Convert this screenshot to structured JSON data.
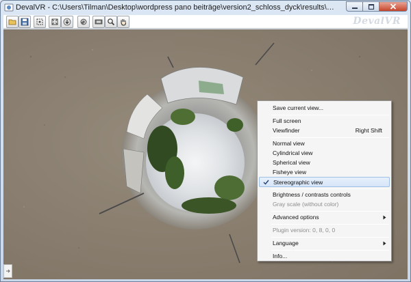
{
  "window": {
    "title": "DevalVR - C:\\Users\\Tilman\\Desktop\\wordpress pano beiträge\\version2_schloss_dyck\\results\\kasse_tag.tif"
  },
  "caption_buttons": [
    "minimize-icon",
    "maximize-icon",
    "close-icon"
  ],
  "toolbar": {
    "buttons": [
      "open-icon",
      "save-icon",
      "fit-icon",
      "zoom-fit-icon",
      "download-icon",
      "rotate-icon",
      "panorama-icon",
      "zoom-icon",
      "hand-icon"
    ],
    "brand": "DevalVR"
  },
  "context_menu": {
    "save_view": "Save current view...",
    "full_screen": "Full screen",
    "viewfinder": "Viewfinder",
    "viewfinder_shortcut": "Right Shift",
    "normal_view": "Normal view",
    "cylindrical_view": "Cylindrical view",
    "spherical_view": "Spherical view",
    "fisheye_view": "Fisheye view",
    "stereographic_view": "Stereographic view",
    "brightness": "Brightness / contrasts controls",
    "gray_scale": "Gray scale (without color)",
    "advanced": "Advanced options",
    "plugin_version": "Plugin version: 0, 8, 0, 0",
    "language": "Language",
    "info": "Info..."
  },
  "colors": {
    "menu_highlight": "#d6e5f8",
    "close_button": "#c5452b",
    "gravel": "#8a7f70"
  }
}
